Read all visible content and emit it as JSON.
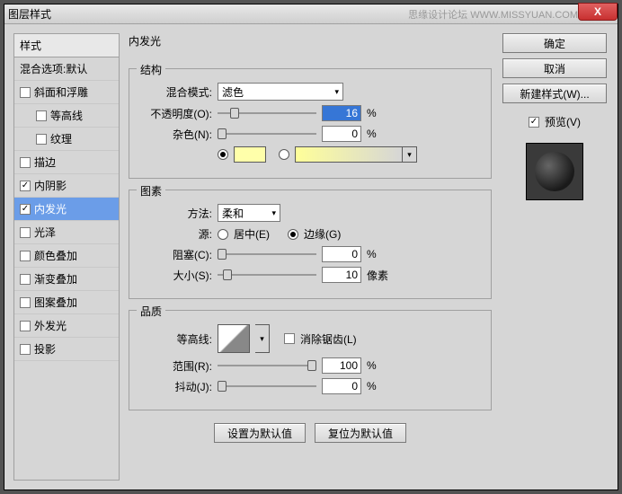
{
  "window": {
    "title": "图层样式",
    "watermark": "思缘设计论坛 WWW.MISSYUAN.COM",
    "close": "X"
  },
  "sidebar": {
    "header": "样式",
    "blendDefault": "混合选项:默认",
    "items": [
      {
        "label": "斜面和浮雕",
        "checked": false,
        "indent": false
      },
      {
        "label": "等高线",
        "checked": false,
        "indent": true
      },
      {
        "label": "纹理",
        "checked": false,
        "indent": true
      },
      {
        "label": "描边",
        "checked": false,
        "indent": false
      },
      {
        "label": "内阴影",
        "checked": true,
        "indent": false
      },
      {
        "label": "内发光",
        "checked": true,
        "indent": false,
        "selected": true
      },
      {
        "label": "光泽",
        "checked": false,
        "indent": false
      },
      {
        "label": "颜色叠加",
        "checked": false,
        "indent": false
      },
      {
        "label": "渐变叠加",
        "checked": false,
        "indent": false
      },
      {
        "label": "图案叠加",
        "checked": false,
        "indent": false
      },
      {
        "label": "外发光",
        "checked": false,
        "indent": false
      },
      {
        "label": "投影",
        "checked": false,
        "indent": false
      }
    ]
  },
  "panel": {
    "title": "内发光",
    "structure": {
      "legend": "结构",
      "blendMode": {
        "label": "混合模式:",
        "value": "滤色"
      },
      "opacity": {
        "label": "不透明度(O):",
        "value": "16",
        "unit": "%"
      },
      "noise": {
        "label": "杂色(N):",
        "value": "0",
        "unit": "%"
      },
      "swatchColor": "#ffffaa"
    },
    "elements": {
      "legend": "图素",
      "technique": {
        "label": "方法:",
        "value": "柔和"
      },
      "source": {
        "label": "源:",
        "center": "居中(E)",
        "edge": "边缘(G)"
      },
      "choke": {
        "label": "阻塞(C):",
        "value": "0",
        "unit": "%"
      },
      "size": {
        "label": "大小(S):",
        "value": "10",
        "unit": "像素"
      }
    },
    "quality": {
      "legend": "品质",
      "contour": {
        "label": "等高线:",
        "antiAlias": "消除锯齿(L)"
      },
      "range": {
        "label": "范围(R):",
        "value": "100",
        "unit": "%"
      },
      "jitter": {
        "label": "抖动(J):",
        "value": "0",
        "unit": "%"
      }
    },
    "buttons": {
      "setDefault": "设置为默认值",
      "reset": "复位为默认值"
    }
  },
  "right": {
    "ok": "确定",
    "cancel": "取消",
    "newStyle": "新建样式(W)...",
    "preview": "预览(V)"
  }
}
